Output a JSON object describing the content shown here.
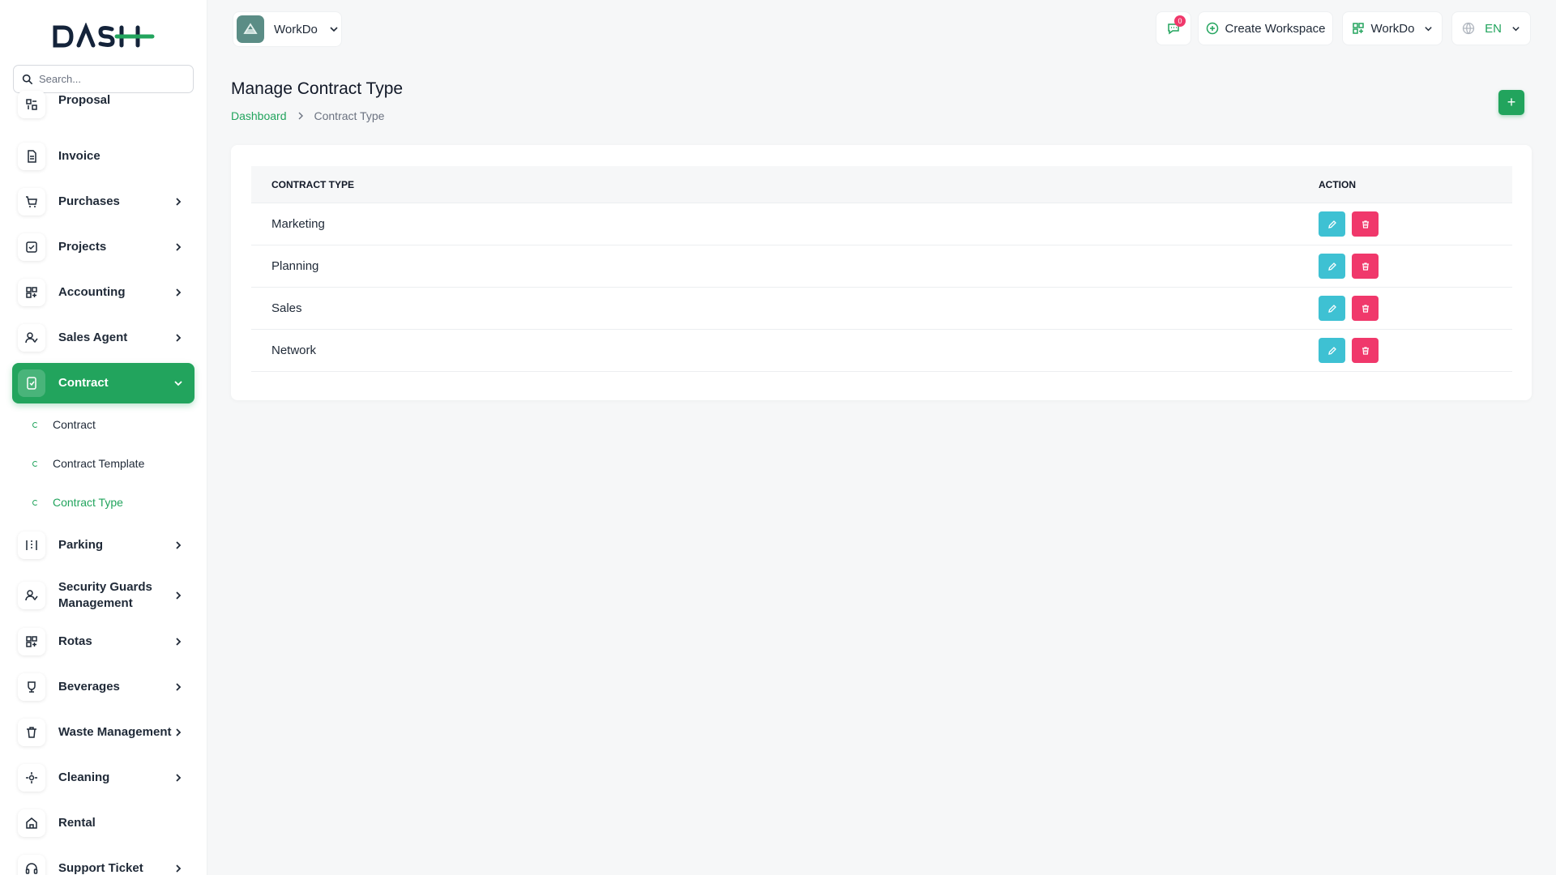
{
  "brand": {
    "logo_text": "DASH"
  },
  "search": {
    "placeholder": "Search..."
  },
  "sidebar": {
    "items": [
      {
        "label": "Proposal",
        "icon": "proposal-icon",
        "has_children": false
      },
      {
        "label": "Invoice",
        "icon": "file-icon",
        "has_children": false
      },
      {
        "label": "Purchases",
        "icon": "cart-icon",
        "has_children": true
      },
      {
        "label": "Projects",
        "icon": "check-square-icon",
        "has_children": true
      },
      {
        "label": "Accounting",
        "icon": "grid-icon",
        "has_children": true
      },
      {
        "label": "Sales Agent",
        "icon": "user-check-icon",
        "has_children": true
      },
      {
        "label": "Contract",
        "icon": "contract-icon",
        "has_children": true,
        "active": true
      },
      {
        "label": "Parking",
        "icon": "parking-icon",
        "has_children": true
      },
      {
        "label": "Security Guards Management",
        "icon": "user-check-icon",
        "has_children": true
      },
      {
        "label": "Rotas",
        "icon": "grid-icon",
        "has_children": true
      },
      {
        "label": "Beverages",
        "icon": "cup-icon",
        "has_children": true
      },
      {
        "label": "Waste Management",
        "icon": "trash-icon",
        "has_children": true
      },
      {
        "label": "Cleaning",
        "icon": "sparkle-icon",
        "has_children": true
      },
      {
        "label": "Rental",
        "icon": "home-icon",
        "has_children": false
      },
      {
        "label": "Support Ticket",
        "icon": "headset-icon",
        "has_children": true
      }
    ],
    "contract_children": [
      {
        "label": "Contract"
      },
      {
        "label": "Contract Template"
      },
      {
        "label": "Contract Type",
        "current": true
      }
    ]
  },
  "header": {
    "workspace_name": "WorkDo",
    "notification_count": "0",
    "create_workspace_label": "Create Workspace",
    "user_workspace_label": "WorkDo",
    "language_label": "EN"
  },
  "main": {
    "title": "Manage Contract Type",
    "breadcrumb": {
      "home": "Dashboard",
      "current": "Contract Type"
    },
    "add_label": "+",
    "table": {
      "headers": {
        "type": "CONTRACT TYPE",
        "action": "ACTION"
      },
      "rows": [
        {
          "type": "Marketing"
        },
        {
          "type": "Planning"
        },
        {
          "type": "Sales"
        },
        {
          "type": "Network"
        }
      ]
    }
  },
  "colors": {
    "accent": "#22a45d",
    "edit": "#3ec1d3",
    "delete": "#f0386b",
    "badge": "#f0386b"
  }
}
